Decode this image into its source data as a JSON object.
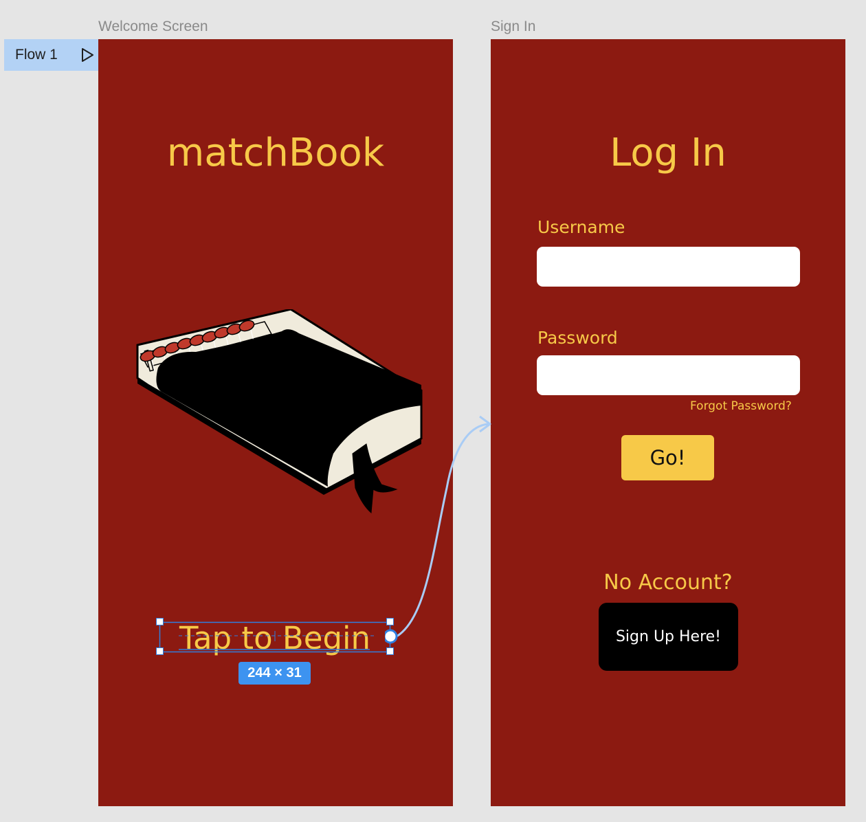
{
  "canvas": {
    "flow_tag": {
      "label": "Flow 1",
      "icon": "play-icon"
    },
    "frames": [
      {
        "label": "Welcome Screen"
      },
      {
        "label": "Sign In"
      }
    ]
  },
  "welcome": {
    "title": "matchBook",
    "illustration": "matchbook-book-illustration",
    "cta": "Tap to Begin",
    "selection_size": "244 × 31"
  },
  "signin": {
    "title": "Log In",
    "username_label": "Username",
    "username_value": "",
    "password_label": "Password",
    "password_value": "",
    "forgot_link": "Forgot Password?",
    "go_button": "Go!",
    "no_account": "No Account?",
    "signup_button": "Sign Up Here!"
  },
  "colors": {
    "canvas_bg": "#e5e5e5",
    "frame_bg": "#8c1a11",
    "accent_yellow": "#f7c948",
    "selection_blue": "#2f7fe0",
    "prototype_arrow": "#a9ccf5"
  }
}
